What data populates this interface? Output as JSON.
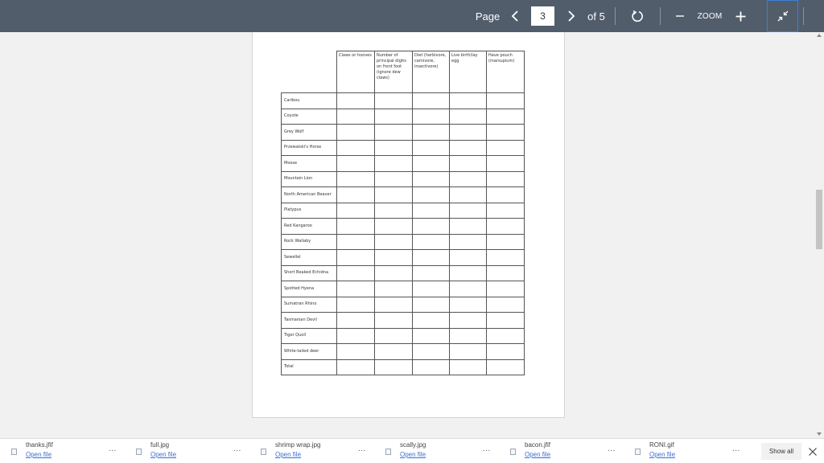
{
  "toolbar": {
    "page_label": "Page",
    "current_page": "3",
    "of_label": "of 5",
    "zoom_label": "ZOOM"
  },
  "document": {
    "headers": [
      "",
      "Claws or hooves",
      "Number of principal digits on front foot (ignore dew claws)",
      "Diet (herbivore, carnivore, insectivore)",
      "Live birth/lay egg",
      "Have pouch (marsupium)"
    ],
    "rows": [
      "Caribou",
      "Coyote",
      "Grey Wolf",
      "Przewalski's Horse",
      "Moose",
      "Mountain Lion",
      "North American Beaver",
      "Platypus",
      "Red Kangaroo",
      "Rock Wallaby",
      "Sewellel",
      "Short Beaked Echidna",
      "Spotted Hyena",
      "Sumatran Rhino",
      "Tasmanian Devil",
      "Tiger Quoll",
      "White-tailed deer",
      "Total"
    ]
  },
  "downloads": {
    "open_label": "Open file",
    "more_label": "...",
    "items": [
      {
        "name": "thanks.jfif"
      },
      {
        "name": "full.jpg"
      },
      {
        "name": "shrimp wrap.jpg"
      },
      {
        "name": "scally.jpg"
      },
      {
        "name": "bacon.jfif"
      },
      {
        "name": "RONI.gif"
      }
    ],
    "show_all_label": "Show all"
  }
}
